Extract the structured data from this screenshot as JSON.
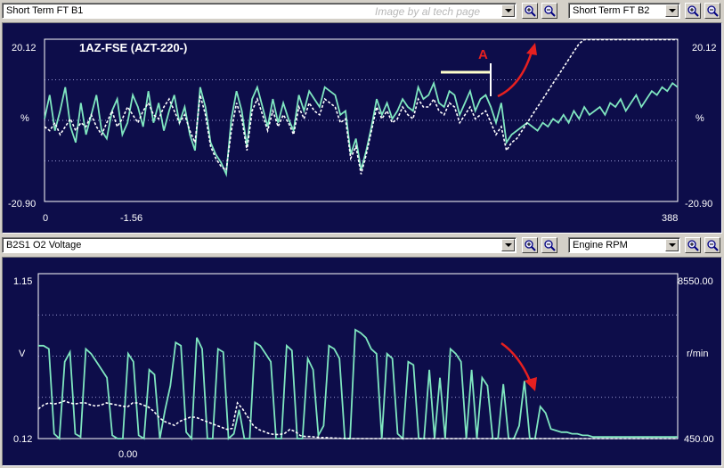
{
  "top_toolbar": {
    "left_select": "Short Term FT B1",
    "watermark": "Image by al tech page",
    "right_select": "Short Term FT B2"
  },
  "bottom_toolbar": {
    "left_select": "B2S1 O2 Voltage",
    "right_select": "Engine RPM"
  },
  "chart_data": [
    {
      "type": "line",
      "title": "1AZ-FSE (AZT-220-)",
      "annotation": "A",
      "ylabel_left": "%",
      "ylabel_right": "%",
      "y_left": {
        "max_label": "20.12",
        "min_label": "-20.90",
        "range": [
          -20.9,
          20.12
        ]
      },
      "y_right": {
        "max_label": "20.12",
        "min_label": "-20.90",
        "range": [
          -20.9,
          20.12
        ]
      },
      "x_ticks": [
        "0",
        "-1.56",
        "388"
      ],
      "series": [
        {
          "color": "#7fe6c0",
          "dashed": false,
          "values": [
            0,
            6,
            -3,
            2,
            8,
            -2,
            -6,
            4,
            -4,
            1,
            6,
            -3,
            -5,
            2,
            5,
            -4,
            -1,
            6,
            3,
            -2,
            7,
            -1,
            4,
            -3,
            2,
            6,
            -1,
            3,
            -4,
            -8,
            8,
            3,
            -6,
            -9,
            -11,
            -14,
            0,
            7,
            2,
            -7,
            5,
            8,
            3,
            -2,
            5,
            -1,
            4,
            0,
            -3,
            6,
            2,
            7,
            5,
            3,
            8,
            7,
            6,
            1,
            2,
            -9,
            -5,
            -13,
            -8,
            -2,
            5,
            1,
            4,
            0,
            2,
            5,
            3,
            2,
            8,
            5,
            6,
            9,
            4,
            3,
            7,
            6,
            1,
            4,
            7,
            2,
            5,
            6,
            3,
            -1,
            4,
            -6,
            -4,
            -3,
            -2,
            -1,
            -2,
            -3,
            -1,
            -2,
            0,
            -1,
            1,
            -1,
            2,
            0,
            3,
            1,
            2,
            3,
            1,
            4,
            3,
            5,
            2,
            4,
            6,
            3,
            5,
            7,
            6,
            8,
            7,
            9,
            8
          ]
        },
        {
          "color": "#ffffff",
          "dashed": true,
          "values": [
            -2,
            -3,
            -1,
            -4,
            -2,
            0,
            -3,
            -1,
            -2,
            1,
            -2,
            -4,
            -1,
            2,
            -2,
            0,
            3,
            1,
            -1,
            2,
            4,
            1,
            0,
            3,
            5,
            2,
            -1,
            1,
            -3,
            -6,
            6,
            1,
            -7,
            -10,
            -12,
            -13,
            -3,
            4,
            0,
            -8,
            2,
            5,
            1,
            -3,
            2,
            -2,
            1,
            -1,
            -4,
            3,
            0,
            4,
            2,
            1,
            5,
            4,
            3,
            -1,
            0,
            -10,
            -7,
            -14,
            -9,
            -3,
            3,
            0,
            2,
            -1,
            0,
            3,
            1,
            0,
            5,
            3,
            3,
            5,
            2,
            1,
            4,
            3,
            -1,
            1,
            3,
            0,
            1,
            2,
            -1,
            -4,
            -2,
            -8,
            -6,
            -5,
            -3,
            -1,
            1,
            3,
            5,
            7,
            9,
            11,
            13,
            15,
            17,
            19,
            20,
            20,
            20,
            20,
            20,
            20,
            20,
            20,
            20,
            20,
            20,
            20,
            20,
            20,
            20,
            20,
            20,
            20,
            20
          ]
        }
      ]
    },
    {
      "type": "line",
      "ylabel_left": "V",
      "ylabel_right": "r/min",
      "y_left": {
        "max_label": "1.15",
        "min_label": "0.12",
        "range": [
          0.12,
          1.15
        ]
      },
      "y_right": {
        "max_label": "8550.00",
        "min_label": "450.00",
        "range": [
          450,
          8550
        ]
      },
      "x_ticks": [
        "0.00"
      ],
      "series": [
        {
          "color": "#7fe6c0",
          "dashed": false,
          "axis": "left",
          "values": [
            0.7,
            0.7,
            0.68,
            0.15,
            0.12,
            0.6,
            0.66,
            0.15,
            0.13,
            0.68,
            0.65,
            0.6,
            0.55,
            0.5,
            0.14,
            0.12,
            0.12,
            0.65,
            0.6,
            0.14,
            0.12,
            0.55,
            0.52,
            0.12,
            0.3,
            0.45,
            0.72,
            0.7,
            0.16,
            0.12,
            0.75,
            0.68,
            0.12,
            0.12,
            0.68,
            0.66,
            0.12,
            0.15,
            0.3,
            0.12,
            0.12,
            0.72,
            0.7,
            0.65,
            0.6,
            0.12,
            0.12,
            0.7,
            0.67,
            0.12,
            0.12,
            0.62,
            0.55,
            0.14,
            0.2,
            0.7,
            0.68,
            0.62,
            0.12,
            0.12,
            0.8,
            0.78,
            0.75,
            0.68,
            0.65,
            0.12,
            0.65,
            0.62,
            0.15,
            0.12,
            0.6,
            0.58,
            0.12,
            0.12,
            0.55,
            0.12,
            0.5,
            0.12,
            0.68,
            0.65,
            0.6,
            0.12,
            0.55,
            0.12,
            0.5,
            0.45,
            0.12,
            0.12,
            0.46,
            0.12,
            0.12,
            0.2,
            0.48,
            0.12,
            0.12,
            0.32,
            0.28,
            0.18,
            0.17,
            0.16,
            0.16,
            0.15,
            0.15,
            0.14,
            0.14,
            0.13,
            0.13,
            0.13,
            0.13,
            0.13,
            0.13,
            0.13,
            0.13,
            0.13,
            0.13,
            0.13,
            0.13,
            0.13,
            0.13,
            0.13,
            0.13,
            0.13
          ]
        },
        {
          "color": "#ffffff",
          "dashed": true,
          "axis": "right",
          "values": [
            1900,
            2100,
            2200,
            2150,
            2200,
            2300,
            2200,
            2150,
            2200,
            2200,
            2100,
            2050,
            2100,
            2200,
            2150,
            2100,
            2050,
            2000,
            2200,
            2200,
            2100,
            2000,
            1800,
            1500,
            1300,
            1200,
            1100,
            1300,
            1400,
            1500,
            1500,
            1400,
            1300,
            1200,
            1100,
            1000,
            900,
            950,
            2200,
            1900,
            1500,
            1100,
            900,
            800,
            700,
            650,
            650,
            700,
            900,
            800,
            600,
            550,
            550,
            520,
            500,
            500,
            480,
            470,
            460,
            460,
            450,
            450,
            450,
            450,
            450,
            450,
            450,
            450,
            450,
            450,
            450,
            450,
            450,
            450,
            450,
            450,
            450,
            450,
            450,
            450,
            450,
            450,
            450,
            450,
            450,
            450,
            450,
            450,
            450,
            450,
            450,
            450,
            450,
            450,
            450,
            450,
            450,
            450,
            450,
            450,
            450,
            450,
            450,
            450,
            450,
            450,
            450,
            450,
            450,
            450,
            450,
            450,
            450,
            450,
            450,
            450,
            450,
            450,
            450,
            450,
            450,
            450,
            450
          ]
        }
      ]
    }
  ]
}
